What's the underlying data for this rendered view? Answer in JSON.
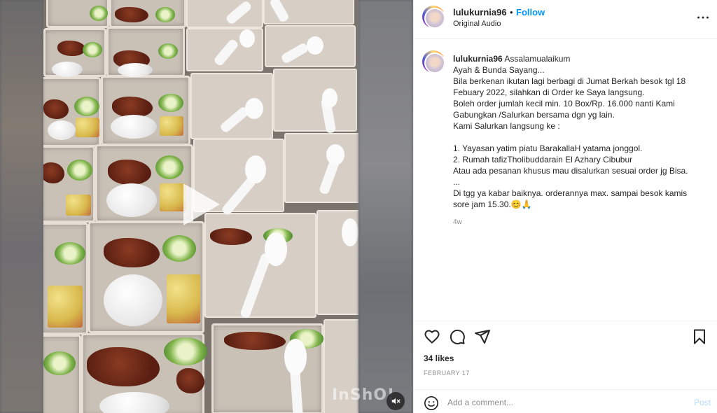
{
  "post": {
    "username": "lulukurnia96",
    "separator": "•",
    "follow_label": "Follow",
    "audio_label": "Original Audio",
    "more_icon": "more-horizontal-icon"
  },
  "media": {
    "watermark": "InShO!",
    "play_icon": "play-icon",
    "mute_icon": "speaker-muted-icon"
  },
  "caption": {
    "username": "lulukurnia96",
    "lines": [
      "Assalamualaikum",
      "Ayah & Bunda Sayang...",
      "Bila berkenan ikutan lagi berbagi di Jumat Berkah besok tgl 18 Febuary 2022, silahkan di Order ke Saya langsung.",
      "Boleh order jumlah kecil min. 10 Box/Rp. 16.000 nanti Kami Gabungkan /Salurkan bersama dgn yg lain.",
      "Kami Salurkan langsung ke :",
      "",
      "1. Yayasan yatim piatu BarakallaH yatama jonggol.",
      "2. Rumah tafizTholibuddarain El Azhary Cibubur",
      "Atau ada pesanan khusus mau disalurkan sesuai order jg Bisa.",
      "...",
      "Di tgg ya kabar baiknya. orderannya max. sampai besok kamis sore jam 15.30.😊🙏"
    ],
    "time_ago": "4w"
  },
  "actions": {
    "like_icon": "heart-icon",
    "comment_icon": "comment-icon",
    "share_icon": "share-icon",
    "save_icon": "bookmark-icon"
  },
  "likes_text": "34 likes",
  "date_text": "FEBRUARY 17",
  "comment": {
    "emoji_icon": "emoji-icon",
    "placeholder": "Add a comment...",
    "post_label": "Post"
  },
  "colors": {
    "accent": "#0095f6",
    "post_disabled": "#b3dbff",
    "text": "#262626",
    "muted": "#8e8e8e"
  }
}
